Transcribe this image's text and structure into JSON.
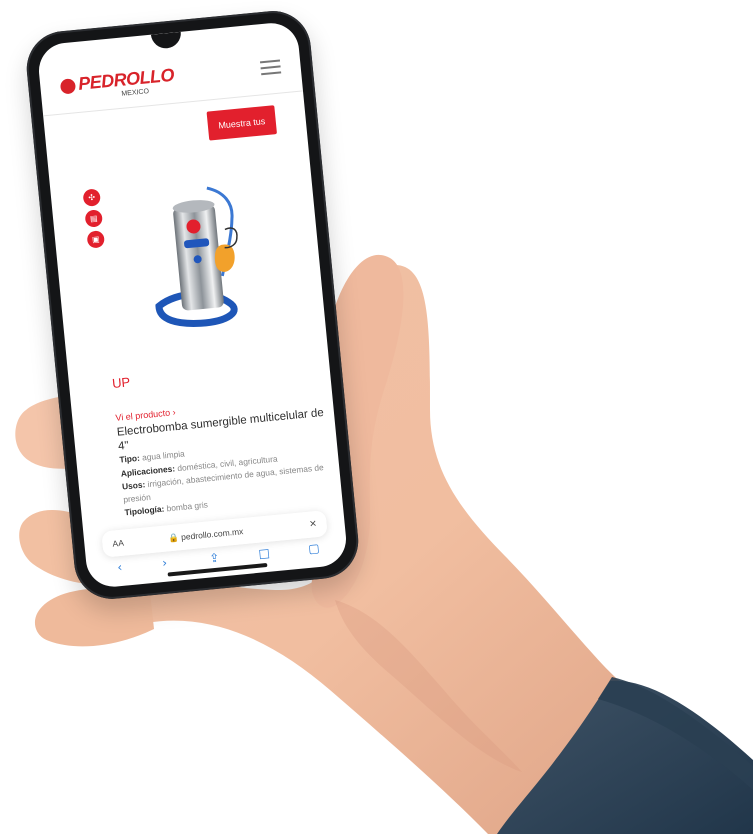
{
  "brand": {
    "name": "PEDROLLO",
    "subtitle": "MEXICO"
  },
  "header": {
    "menu_icon": "hamburger-menu-icon"
  },
  "buttons": {
    "primary_label": "Muestra tus"
  },
  "side_actions": [
    {
      "icon": "fan-icon",
      "glyph": "✣"
    },
    {
      "icon": "document-icon",
      "glyph": "▤"
    },
    {
      "icon": "print-icon",
      "glyph": "▣"
    }
  ],
  "product": {
    "name": "UP",
    "breadcrumb": "Vi el producto ›",
    "description": "Electrobomba sumergible multicelular de 4\"",
    "specs": [
      {
        "label": "Tipo:",
        "value": " agua limpia"
      },
      {
        "label": "Aplicaciones:",
        "value": " doméstica, civil, agricultura"
      },
      {
        "label": "Usos:",
        "value": " irrigación, abastecimiento de agua, sistemas de presión"
      },
      {
        "label": "Tipología:",
        "value": " bomba gris"
      }
    ]
  },
  "browser": {
    "left_label": "AA",
    "lock_icon": "lock-icon",
    "url": "🔒 pedrollo.com.mx",
    "close_label": "×"
  },
  "browser_nav": [
    {
      "icon": "back-icon",
      "glyph": "‹"
    },
    {
      "icon": "forward-icon",
      "glyph": "›"
    },
    {
      "icon": "share-icon",
      "glyph": "⇪"
    },
    {
      "icon": "bookmarks-icon",
      "glyph": "□"
    },
    {
      "icon": "tabs-icon",
      "glyph": "▢"
    }
  ],
  "colors": {
    "accent": "#e2202d",
    "phone": "#141517",
    "sleeve": "#2d4052"
  }
}
